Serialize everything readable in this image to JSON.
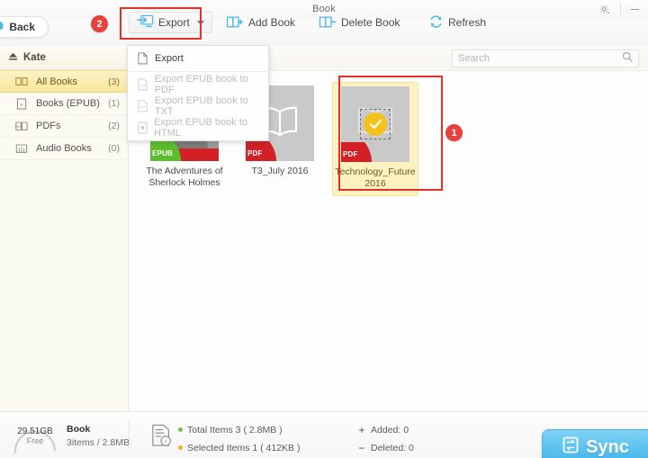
{
  "window": {
    "title": "Book",
    "gear_icon": "gear-icon",
    "minimize_icon": "minimize-icon"
  },
  "toolbar": {
    "back_label": "Back",
    "back_icon": "home-icon",
    "items": [
      {
        "label": "Export",
        "icon": "export-monitor-icon",
        "has_caret": true
      },
      {
        "label": "Add Book",
        "icon": "book-plus-icon",
        "has_caret": false
      },
      {
        "label": "Delete Book",
        "icon": "book-minus-icon",
        "has_caret": false
      },
      {
        "label": "Refresh",
        "icon": "refresh-icon",
        "has_caret": false
      }
    ]
  },
  "annotations": [
    {
      "number": "2",
      "target": "export-button"
    },
    {
      "number": "1",
      "target": "selected-book"
    }
  ],
  "export_menu": {
    "items": [
      {
        "label": "Export",
        "icon": "file-icon",
        "disabled": false
      },
      {
        "label": "Export EPUB book to PDF",
        "icon": "pdf-file-icon",
        "disabled": true
      },
      {
        "label": "Export EPUB book to TXT",
        "icon": "txt-file-icon",
        "disabled": true
      },
      {
        "label": "Export EPUB book to HTML",
        "icon": "html-file-icon",
        "disabled": true
      }
    ]
  },
  "sidebar": {
    "device": {
      "label": "Kate",
      "icon": "eject-icon"
    },
    "items": [
      {
        "label": "All Books",
        "count": "(3)",
        "icon": "book-open-icon",
        "active": true
      },
      {
        "label": "Books (EPUB)",
        "count": "(1)",
        "icon": "epub-file-icon",
        "active": false
      },
      {
        "label": "PDFs",
        "count": "(2)",
        "icon": "pdf-book-icon",
        "active": false
      },
      {
        "label": "Audio Books",
        "count": "(0)",
        "icon": "audiobook-icon",
        "active": false
      }
    ]
  },
  "search": {
    "placeholder": "Search",
    "value": "",
    "icon": "search-icon"
  },
  "books": [
    {
      "title": "The Adventures of Sherlock Holmes",
      "format": "EPUB",
      "cover_type": "photo",
      "selected": false
    },
    {
      "title": "T3_July 2016",
      "format": "PDF",
      "cover_type": "placeholder",
      "selected": false
    },
    {
      "title": "Technology_Future2016",
      "format": "PDF",
      "cover_type": "placeholder",
      "selected": true
    }
  ],
  "status": {
    "storage_value": "29.51GB",
    "storage_label": "Free",
    "device_name": "Book",
    "device_detail": "3items / 2.8MB",
    "total_items": "Total Items 3 ( 2.8MB )",
    "selected_items": "Selected Items 1 ( 412KB )",
    "added": "Added: 0",
    "deleted": "Deleted: 0",
    "added_sign": "+",
    "deleted_sign": "−",
    "sync_label": "Sync",
    "sync_icon": "sync-icon"
  },
  "colors": {
    "accent_blue": "#3fb3e8",
    "annotation_red": "#e8302a",
    "badge_red": "#e8413c",
    "selection_yellow": "#fdf2c0",
    "pdf_red": "#d32027",
    "epub_green": "#5dbb2e",
    "check_yellow": "#f5c21b"
  }
}
